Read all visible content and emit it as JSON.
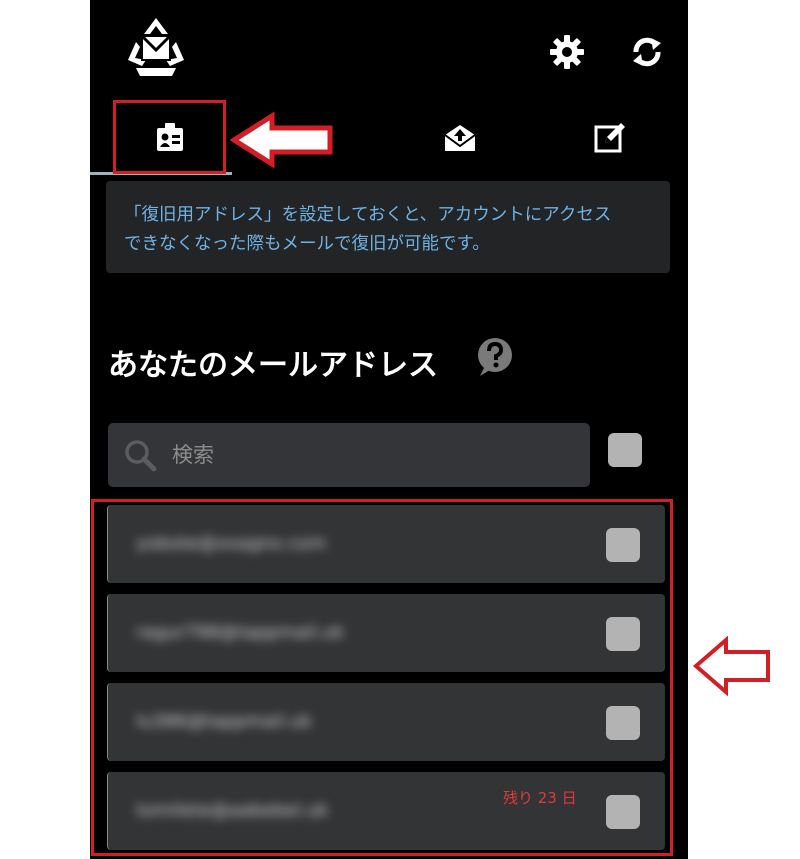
{
  "header": {
    "logo_icon": "recycle-mail-logo",
    "settings_icon": "gear-icon",
    "refresh_icon": "refresh-icon"
  },
  "tabs": [
    {
      "name": "addresses",
      "icon": "id-badge-icon",
      "active": true
    },
    {
      "name": "inbox",
      "icon": "envelope-upload-icon",
      "active": false
    },
    {
      "name": "compose",
      "icon": "pencil-square-icon",
      "active": false
    }
  ],
  "info": {
    "text_line1": "「復旧用アドレス」を設定しておくと、アカウントにアクセス",
    "text_line2": "できなくなった際もメールで復旧が可能です。"
  },
  "section": {
    "title": "あなたのメールアドレス",
    "help_icon": "question-bubble-icon"
  },
  "search": {
    "placeholder": "検索"
  },
  "emails": [
    {
      "address": "yobote@xxagnx.com",
      "badge": ""
    },
    {
      "address": "ragur798@tappmail.uk",
      "badge": ""
    },
    {
      "address": "lu386@tappmail.uk",
      "badge": ""
    },
    {
      "address": "tomilete@aabebel.uk",
      "badge": "残り 23 日"
    }
  ],
  "colors": {
    "annotation": "#d41e26",
    "info_text": "#6fb2e6",
    "background": "#000000",
    "row_bg": "#323436"
  }
}
